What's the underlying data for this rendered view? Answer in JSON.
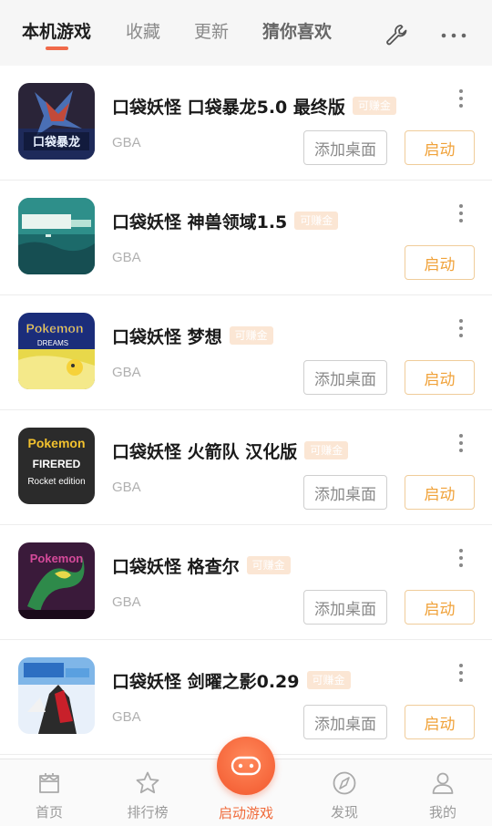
{
  "tabs": [
    {
      "label": "本机游戏",
      "active": true
    },
    {
      "label": "收藏",
      "active": false
    },
    {
      "label": "更新",
      "active": false
    },
    {
      "label": "猜你喜欢",
      "active": false
    }
  ],
  "toolbar": {
    "settings_icon": "wrench-icon",
    "more_icon": "more-horizontal-icon"
  },
  "games": [
    {
      "title": "口袋妖怪 口袋暴龙5.0 最终版",
      "badge": "可赚金",
      "platform": "GBA",
      "add_label": "添加桌面",
      "start_label": "启动",
      "show_add": true,
      "cover_text": "口袋暴龙"
    },
    {
      "title": "口袋妖怪 神兽领域1.5",
      "badge": "可赚金",
      "platform": "GBA",
      "add_label": "",
      "start_label": "启动",
      "show_add": false,
      "cover_text": ""
    },
    {
      "title": "口袋妖怪 梦想",
      "badge": "可赚金",
      "platform": "GBA",
      "add_label": "添加桌面",
      "start_label": "启动",
      "show_add": true,
      "cover_text": "DREAMS"
    },
    {
      "title": "口袋妖怪 火箭队 汉化版",
      "badge": "可赚金",
      "platform": "GBA",
      "add_label": "添加桌面",
      "start_label": "启动",
      "show_add": true,
      "cover_text": "FIRERED"
    },
    {
      "title": "口袋妖怪 格查尔",
      "badge": "可赚金",
      "platform": "GBA",
      "add_label": "添加桌面",
      "start_label": "启动",
      "show_add": true,
      "cover_text": ""
    },
    {
      "title": "口袋妖怪 剑曜之影0.29",
      "badge": "可赚金",
      "platform": "GBA",
      "add_label": "添加桌面",
      "start_label": "启动",
      "show_add": true,
      "cover_text": ""
    }
  ],
  "covers": {
    "c4_line1": "Pokemon",
    "c4_line3": "Rocket edition"
  },
  "bottom_nav": [
    {
      "label": "首页",
      "icon": "home-icon",
      "active": false
    },
    {
      "label": "排行榜",
      "icon": "star-icon",
      "active": false
    },
    {
      "label": "启动游戏",
      "icon": "gamepad-icon",
      "active": true
    },
    {
      "label": "发现",
      "icon": "compass-icon",
      "active": false
    },
    {
      "label": "我的",
      "icon": "user-icon",
      "active": false
    }
  ],
  "colors": {
    "accent": "#f06a3a",
    "start_text": "#f0a23a",
    "badge_bg": "#fbe6d4"
  }
}
